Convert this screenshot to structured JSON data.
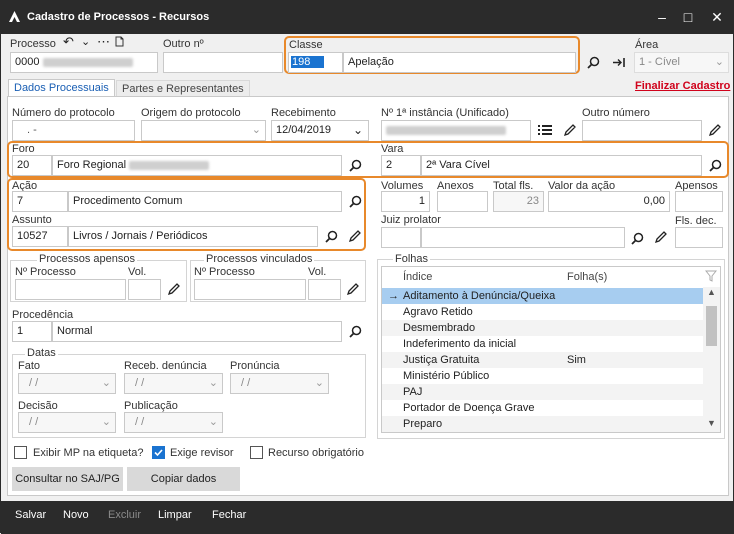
{
  "window": {
    "title": "Cadastro de Processos - Recursos"
  },
  "header": {
    "processo_label": "Processo",
    "processo_value": "0000",
    "outro_no_label": "Outro nº",
    "classe_label": "Classe",
    "classe_code": "198",
    "classe_desc": "Apelação",
    "area_label": "Área",
    "area_value": "1 - Cível"
  },
  "tabs": [
    "Dados Processuais",
    "Partes e Representantes"
  ],
  "finalizar_link": "Finalizar Cadastro",
  "fields": {
    "num_protocolo_label": "Número do protocolo",
    "num_protocolo_value": ". -",
    "origem_label": "Origem do protocolo",
    "recebimento_label": "Recebimento",
    "recebimento_value": "12/04/2019",
    "primeira_instancia_label": "Nº 1ª instância (Unificado)",
    "outro_numero_label": "Outro número",
    "foro_label": "Foro",
    "foro_code": "20",
    "foro_desc": "Foro Regional",
    "vara_label": "Vara",
    "vara_code": "2",
    "vara_desc": "2ª Vara Cível",
    "acao_label": "Ação",
    "acao_code": "7",
    "acao_desc": "Procedimento Comum",
    "assunto_label": "Assunto",
    "assunto_code": "10527",
    "assunto_desc": "Livros / Jornais / Periódicos",
    "volumes_label": "Volumes",
    "volumes_value": "1",
    "anexos_label": "Anexos",
    "total_fls_label": "Total fls.",
    "total_fls_value": "23",
    "valor_acao_label": "Valor da ação",
    "valor_acao_value": "0,00",
    "apensos_label": "Apensos",
    "juiz_label": "Juiz prolator",
    "fls_dec_label": "Fls. dec.",
    "proc_apensos_label": "Processos apensos",
    "proc_vinculados_label": "Processos vinculados",
    "n_processo_label": "Nº Processo",
    "vol_label": "Vol.",
    "procedencia_label": "Procedência",
    "procedencia_code": "1",
    "procedencia_desc": "Normal",
    "datas_label": "Datas",
    "fato_label": "Fato",
    "receb_denuncia_label": "Receb. denúncia",
    "pronuncia_label": "Pronúncia",
    "decisao_label": "Decisão",
    "publicacao_label": "Publicação",
    "empty_date": "/ /"
  },
  "checkboxes": {
    "exibir_mp": {
      "label": "Exibir MP na etiqueta?",
      "checked": false
    },
    "exige_revisor": {
      "label": "Exige revisor",
      "checked": true
    },
    "recurso_obrigatorio": {
      "label": "Recurso obrigatório",
      "checked": false
    }
  },
  "buttons": {
    "consultar": "Consultar no SAJ/PG",
    "copiar": "Copiar dados"
  },
  "folhas": {
    "title": "Folhas",
    "col_indice": "Índice",
    "col_folhas": "Folha(s)",
    "rows": [
      {
        "indice": "Aditamento à Denúncia/Queixa",
        "folhas": ""
      },
      {
        "indice": "Agravo Retido",
        "folhas": ""
      },
      {
        "indice": "Desmembrado",
        "folhas": ""
      },
      {
        "indice": "Indeferimento da inicial",
        "folhas": ""
      },
      {
        "indice": "Justiça Gratuita",
        "folhas": "Sim"
      },
      {
        "indice": "Ministério Público",
        "folhas": ""
      },
      {
        "indice": "PAJ",
        "folhas": ""
      },
      {
        "indice": "Portador de Doença Grave",
        "folhas": ""
      },
      {
        "indice": "Preparo",
        "folhas": ""
      }
    ]
  },
  "footer": {
    "salvar": "Salvar",
    "novo": "Novo",
    "excluir": "Excluir",
    "limpar": "Limpar",
    "fechar": "Fechar"
  },
  "colors": {
    "highlight": "#e8892b",
    "titlebar": "#2b2b2b",
    "selection": "#a7cdf0",
    "link_red": "#d0021b",
    "accent_blue": "#1a73d0"
  }
}
